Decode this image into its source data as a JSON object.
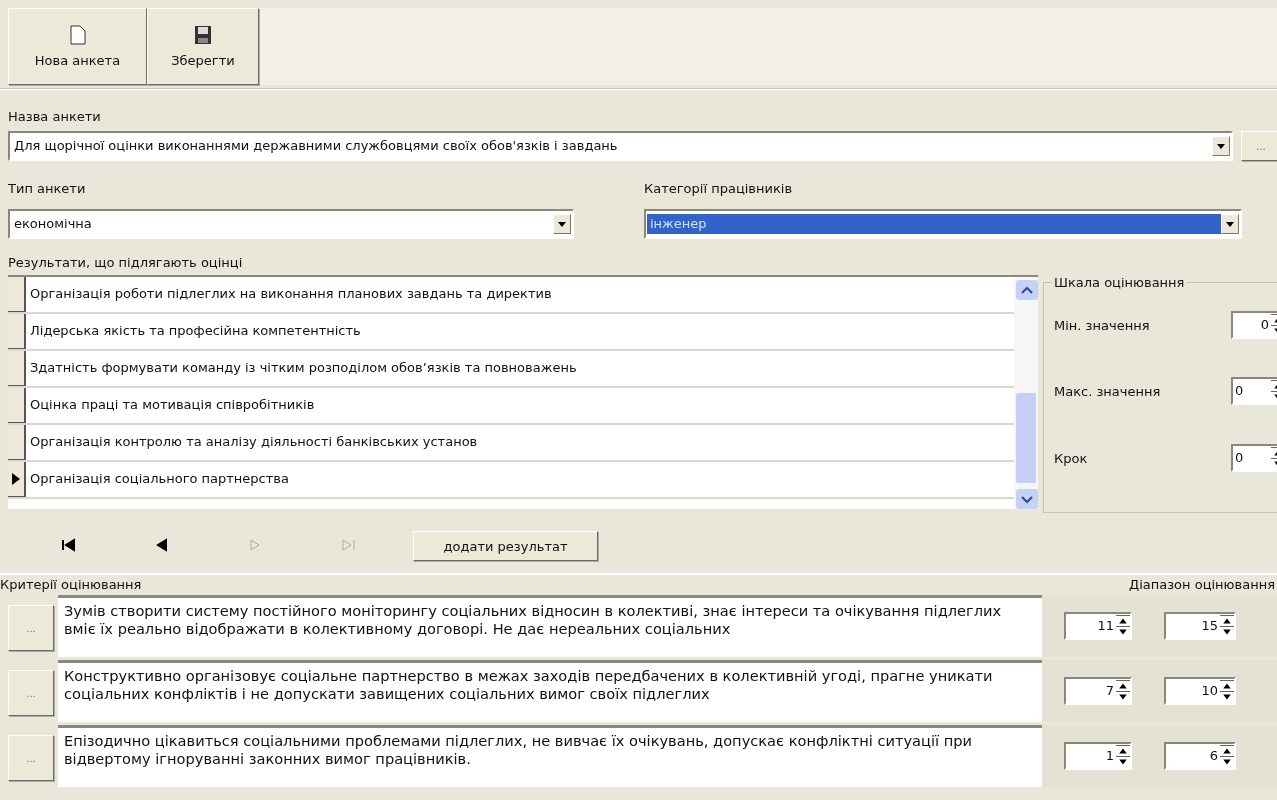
{
  "toolbar": [
    {
      "kind": "new",
      "label": "Нова анкета"
    },
    {
      "kind": "save",
      "label": "Зберегти"
    }
  ],
  "questionnaire_name": {
    "label": "Назва анкети",
    "value": "Для щорічної оцінки виконаннями державними службовцями своїх обов'язків і завдань",
    "browse_button": "..."
  },
  "questionnaire_type": {
    "label": "Тип анкети",
    "value": "економічна"
  },
  "employee_category": {
    "label": "Категорії  працівників",
    "value": "інженер",
    "highlighted": true
  },
  "results": {
    "label": "Результати, що підлягають оцінці",
    "rows": [
      {
        "text": "Організація роботи підлеглих на виконання планових завдань та директив",
        "selected": false
      },
      {
        "text": "Лідерська якість та професійна компетентність",
        "selected": false
      },
      {
        "text": "Здатність формувати команду із чітким розподілом обов’язків та повноважень",
        "selected": false
      },
      {
        "text": "Оцінка праці та мотивація співробітників",
        "selected": false
      },
      {
        "text": "Організація контролю та аналізу діяльності банківських установ",
        "selected": false
      },
      {
        "text": "Організація соціального партнерства",
        "selected": true
      }
    ]
  },
  "scale": {
    "title": "Шкала оцінювання",
    "fields": [
      {
        "label": "Мін. значення",
        "value": "0",
        "right_aligned": true
      },
      {
        "label": "Макс. значення",
        "value": "0",
        "right_aligned": false
      },
      {
        "label": "Крок",
        "value": "0",
        "right_aligned": false
      }
    ]
  },
  "navigation": [
    {
      "kind": "first",
      "disabled": false
    },
    {
      "kind": "prev",
      "disabled": false
    },
    {
      "kind": "next",
      "disabled": true
    },
    {
      "kind": "last",
      "disabled": true
    }
  ],
  "add_result_button": "додати результат",
  "criteria": {
    "label": "Критерії оцінювання",
    "range_label": "Діапазон оцінювання",
    "rows": [
      {
        "button": "...",
        "text": "Зумів створити систему постійного моніторингу соціальних відносин в колективі, знає інтереси та очікування підлеглих вміє їх реально відображати в колективному договорі. Не дає нереальних соціальних",
        "min": "11",
        "max": "15"
      },
      {
        "button": "...",
        "text": "Конструктивно організовує соціальне партнерство в межах заходів передбачених в колективній угоді, прагне уникати соціальних конфліктів і не допускати завищених соціальних вимог своїх підлеглих",
        "min": "7",
        "max": "10"
      },
      {
        "button": "...",
        "text": "Епізодично цікавиться соціальними проблемами підлеглих, не вивчає їх очікувань, допускає конфліктні ситуації при відвертому ігноруванні законних вимог працівників.",
        "min": "1",
        "max": "6"
      }
    ]
  }
}
